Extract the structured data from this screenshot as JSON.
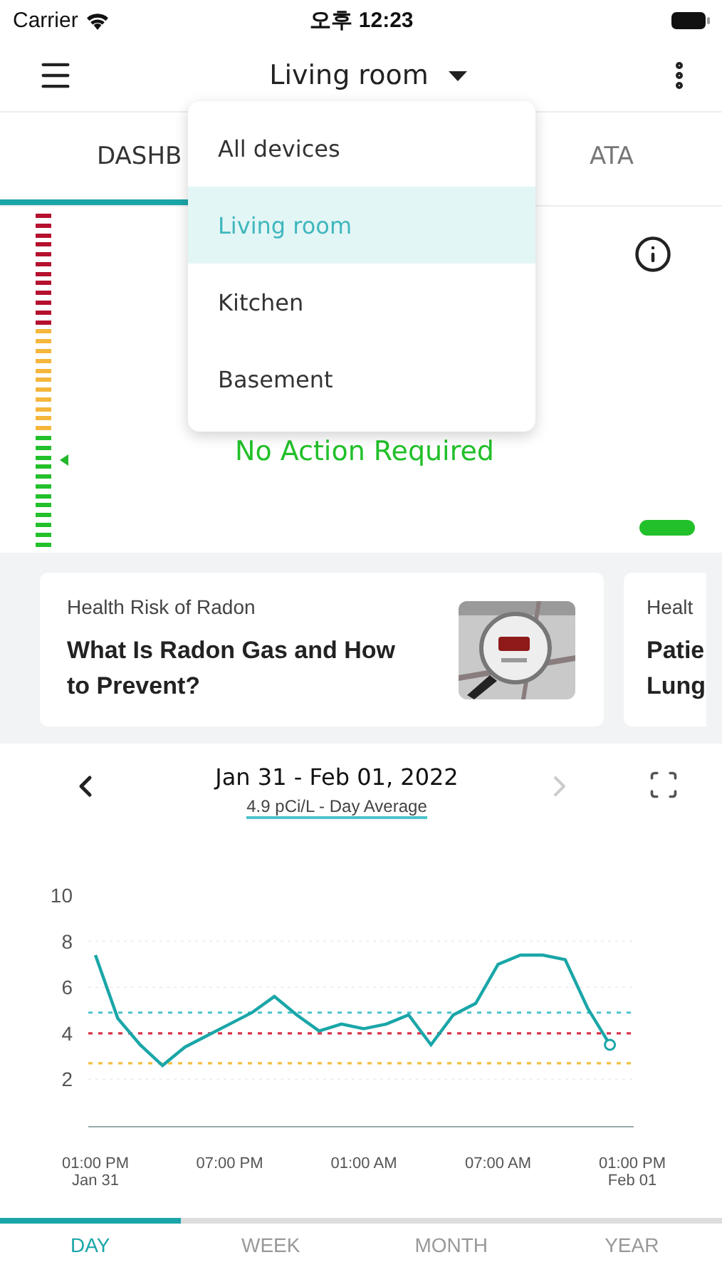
{
  "status_bar": {
    "carrier": "Carrier",
    "time": "오후 12:23"
  },
  "header": {
    "title": "Living room"
  },
  "tabs": [
    {
      "label": "DASHB",
      "selected": true
    },
    {
      "label": "ATA",
      "selected": false
    }
  ],
  "dropdown": {
    "items": [
      {
        "label": "All devices",
        "selected": false
      },
      {
        "label": "Living room",
        "selected": true
      },
      {
        "label": "Kitchen",
        "selected": false
      },
      {
        "label": "Basement",
        "selected": false
      }
    ]
  },
  "gauge": {
    "level": 0.26,
    "status": "No Action Required"
  },
  "articles": [
    {
      "category": "Health Risk of Radon",
      "title": "What Is Radon Gas and How to Prevent?"
    },
    {
      "category": "Healt",
      "title": "Patie Lung"
    }
  ],
  "history": {
    "range": "Jan 31 - Feb 01, 2022",
    "average": "4.9 pCi/L - Day Average",
    "chart_data": {
      "type": "line",
      "categories": [
        "01:00 PM\nJan 31",
        null,
        null,
        null,
        null,
        null,
        "07:00 PM",
        null,
        null,
        null,
        null,
        null,
        "01:00 AM",
        null,
        null,
        null,
        null,
        null,
        "07:00 AM",
        null,
        null,
        null,
        null,
        null,
        "01:00 PM\nFeb 01"
      ],
      "series": [
        {
          "color": "#1aa6a8",
          "values": [
            7.4,
            4.65,
            3.5,
            2.6,
            3.4,
            3.9,
            4.4,
            4.9,
            5.6,
            4.8,
            4.1,
            4.4,
            4.2,
            4.4,
            4.8,
            3.5,
            4.8,
            5.3,
            7.0,
            7.4,
            7.4,
            7.2,
            5.1,
            3.5,
            null
          ]
        }
      ],
      "ylim": [
        0,
        10
      ],
      "yticks": [
        2,
        4,
        6,
        8,
        10
      ],
      "grid": true,
      "ref_lines": [
        {
          "axis": "y",
          "value": 4.9,
          "color": "#4cc3cb"
        },
        {
          "axis": "y",
          "value": 4,
          "color": "#d8344a"
        },
        {
          "axis": "y",
          "value": 2.7,
          "color": "#f2c043"
        }
      ]
    }
  },
  "range_tabs": [
    {
      "label": "DAY",
      "selected": true
    },
    {
      "label": "WEEK",
      "selected": false
    },
    {
      "label": "MONTH",
      "selected": false
    },
    {
      "label": "YEAR",
      "selected": false
    }
  ]
}
